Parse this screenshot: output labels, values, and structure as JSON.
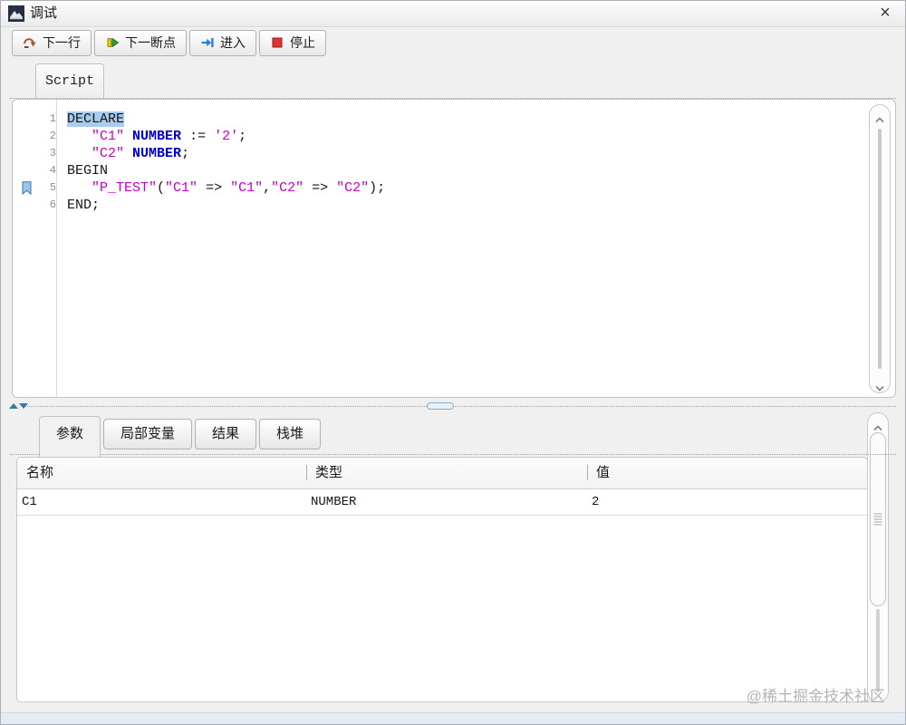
{
  "window": {
    "title": "调试",
    "close_glyph": "×"
  },
  "toolbar": {
    "buttons": [
      {
        "label": "下一行",
        "icon": "step-over-icon"
      },
      {
        "label": "下一断点",
        "icon": "resume-icon"
      },
      {
        "label": "进入",
        "icon": "step-into-icon"
      },
      {
        "label": "停止",
        "icon": "stop-icon"
      }
    ]
  },
  "editor": {
    "tab_label": "Script",
    "current_line": 5,
    "lines": [
      {
        "num": "1",
        "segments": [
          {
            "text": "DECLARE",
            "style": "selected"
          }
        ]
      },
      {
        "num": "2",
        "segments": [
          {
            "text": "   "
          },
          {
            "text": "\"C1\"",
            "style": "string"
          },
          {
            "text": " "
          },
          {
            "text": "NUMBER",
            "style": "keyword"
          },
          {
            "text": " := "
          },
          {
            "text": "'2'",
            "style": "string"
          },
          {
            "text": ";"
          }
        ]
      },
      {
        "num": "3",
        "segments": [
          {
            "text": "   "
          },
          {
            "text": "\"C2\"",
            "style": "string"
          },
          {
            "text": " "
          },
          {
            "text": "NUMBER",
            "style": "keyword"
          },
          {
            "text": ";"
          }
        ]
      },
      {
        "num": "4",
        "segments": [
          {
            "text": "BEGIN"
          }
        ]
      },
      {
        "num": "5",
        "segments": [
          {
            "text": "   "
          },
          {
            "text": "\"P_TEST\"",
            "style": "string"
          },
          {
            "text": "("
          },
          {
            "text": "\"C1\"",
            "style": "string"
          },
          {
            "text": " => "
          },
          {
            "text": "\"C1\"",
            "style": "string"
          },
          {
            "text": ","
          },
          {
            "text": "\"C2\"",
            "style": "string"
          },
          {
            "text": " => "
          },
          {
            "text": "\"C2\"",
            "style": "string"
          },
          {
            "text": ");"
          }
        ]
      },
      {
        "num": "6",
        "segments": [
          {
            "text": "END;"
          }
        ]
      }
    ]
  },
  "bottom_panel": {
    "tabs": [
      {
        "label": "参数",
        "active": true
      },
      {
        "label": "局部变量",
        "active": false
      },
      {
        "label": "结果",
        "active": false
      },
      {
        "label": "栈堆",
        "active": false
      }
    ],
    "table": {
      "columns": [
        "名称",
        "类型",
        "值"
      ],
      "rows": [
        [
          "C1",
          "NUMBER",
          "2"
        ]
      ]
    }
  },
  "watermark": "@稀土掘金技术社区"
}
